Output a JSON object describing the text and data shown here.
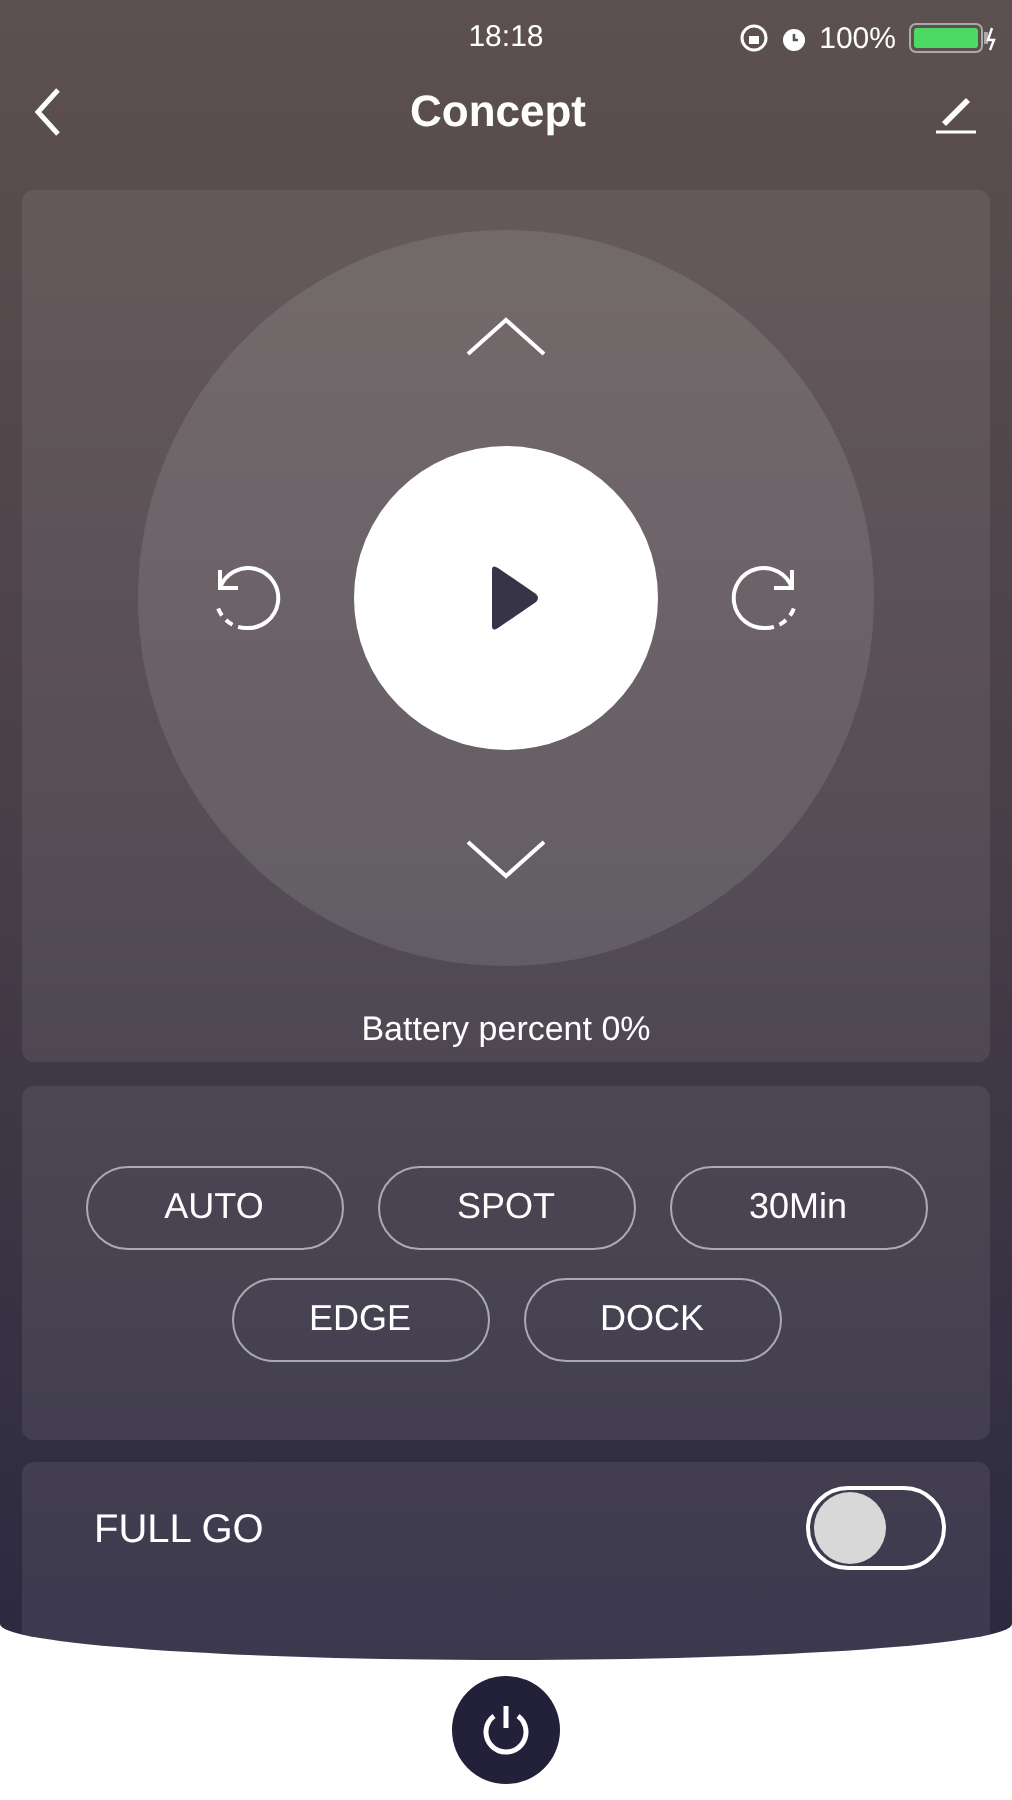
{
  "status_bar": {
    "time": "18:18",
    "battery": "100%"
  },
  "nav": {
    "title": "Concept"
  },
  "remote": {
    "battery_text": "Battery percent 0%"
  },
  "modes": [
    {
      "label": "AUTO"
    },
    {
      "label": "SPOT"
    },
    {
      "label": "30Min"
    },
    {
      "label": "EDGE"
    },
    {
      "label": "DOCK"
    }
  ],
  "full_go": {
    "label": "FULL GO",
    "on": false
  }
}
